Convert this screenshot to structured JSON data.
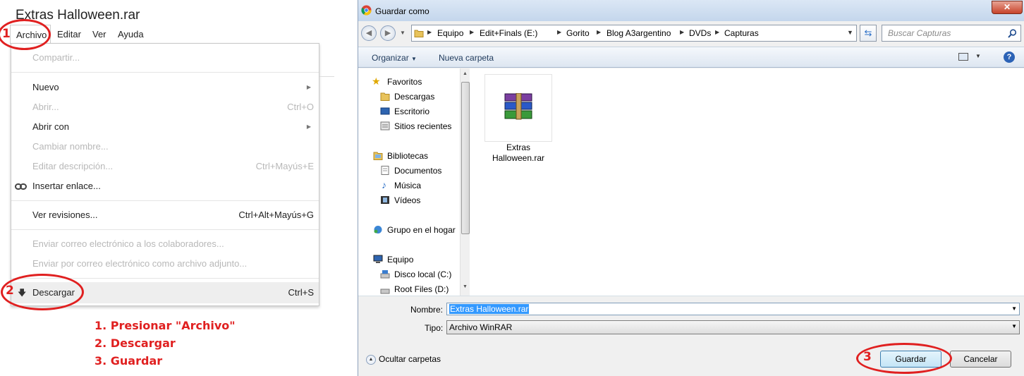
{
  "drive": {
    "doc_title": "Extras Halloween.rar",
    "menubar": [
      "Archivo",
      "Editar",
      "Ver",
      "Ayuda"
    ],
    "menu_items": [
      {
        "label": "Compartir...",
        "shortcut": "",
        "disabled": true
      },
      {
        "label": "Nuevo",
        "shortcut": "",
        "disabled": false,
        "submenu": true
      },
      {
        "label": "Abrir...",
        "shortcut": "Ctrl+O",
        "disabled": true
      },
      {
        "label": "Abrir con",
        "shortcut": "",
        "disabled": false,
        "submenu": true
      },
      {
        "label": "Cambiar nombre...",
        "shortcut": "",
        "disabled": true
      },
      {
        "label": "Editar descripción...",
        "shortcut": "Ctrl+Mayús+E",
        "disabled": true
      },
      {
        "label": "Insertar enlace...",
        "shortcut": "",
        "disabled": false,
        "icon": "link-icon"
      },
      {
        "label": "Ver revisiones...",
        "shortcut": "Ctrl+Alt+Mayús+G",
        "disabled": false
      },
      {
        "label": "Enviar correo electrónico a los colaboradores...",
        "shortcut": "",
        "disabled": true
      },
      {
        "label": "Enviar por correo electrónico como archivo adjunto...",
        "shortcut": "",
        "disabled": true
      },
      {
        "label": "Descargar",
        "shortcut": "Ctrl+S",
        "disabled": false,
        "highlighted": true,
        "icon": "download-arrow-icon"
      }
    ]
  },
  "annotations": {
    "markers": [
      "1",
      "2",
      "3"
    ],
    "steps": [
      "1. Presionar \"Archivo\"",
      "2. Descargar",
      "3. Guardar"
    ],
    "color": "#e02020"
  },
  "dialog": {
    "title": "Guardar como",
    "close_glyph": "✕",
    "breadcrumb": [
      "Equipo",
      "Edit+Finals (E:)",
      "Gorito",
      "Blog A3argentino",
      "DVDs",
      "Capturas"
    ],
    "search_placeholder": "Buscar Capturas",
    "toolbar": {
      "organize": "Organizar",
      "new_folder": "Nueva carpeta"
    },
    "nav": {
      "favorites": {
        "label": "Favoritos",
        "items": [
          "Descargas",
          "Escritorio",
          "Sitios recientes"
        ]
      },
      "libraries": {
        "label": "Bibliotecas",
        "items": [
          "Documentos",
          "Música",
          "Vídeos"
        ]
      },
      "homegroup": "Grupo en el hogar",
      "computer": {
        "label": "Equipo",
        "items": [
          "Disco local (C:)",
          "Root Files (D:)"
        ]
      }
    },
    "file": {
      "name_line1": "Extras",
      "name_line2": "Halloween.rar",
      "icon": "winrar-archive-icon"
    },
    "name_label": "Nombre:",
    "name_value": "Extras Halloween.rar",
    "type_label": "Tipo:",
    "type_value": "Archivo WinRAR",
    "hide_folders": "Ocultar carpetas",
    "save": "Guardar",
    "cancel": "Cancelar"
  }
}
